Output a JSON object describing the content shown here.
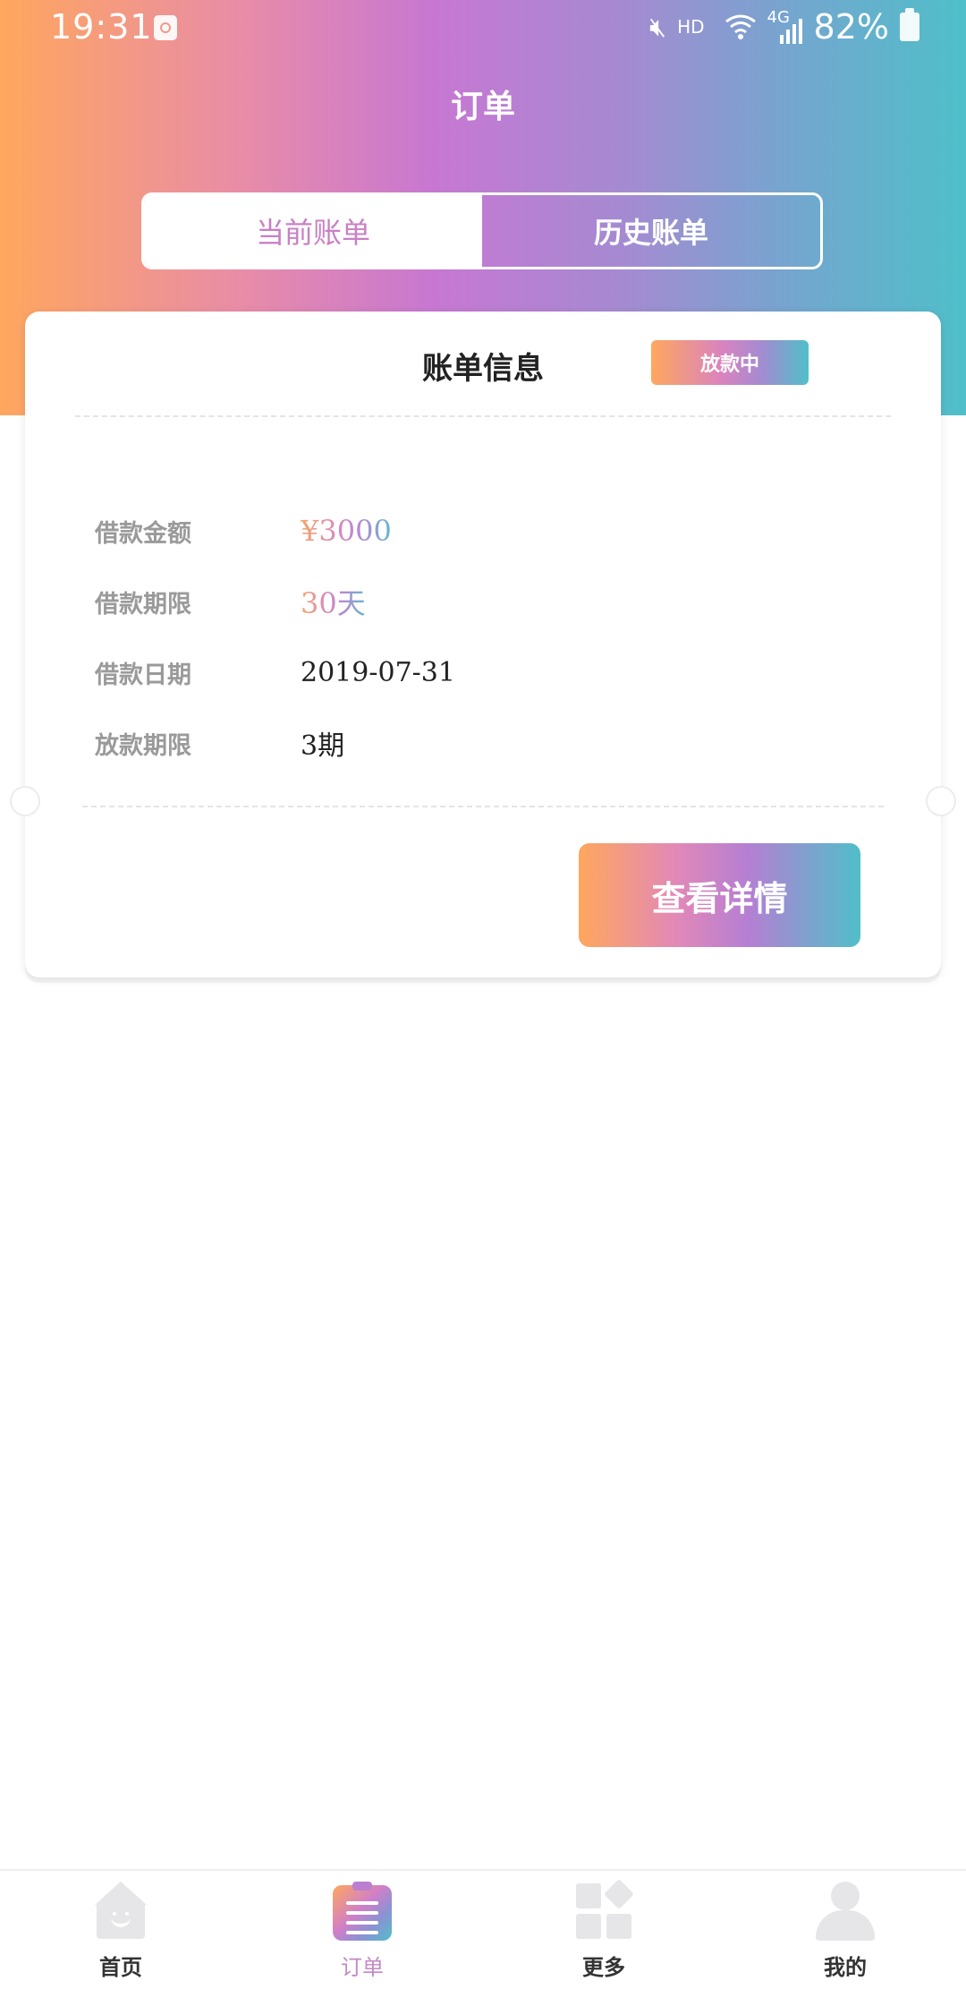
{
  "status_bar": {
    "time": "19:31",
    "hd": "HD",
    "network": "4G",
    "battery": "82%",
    "icons": [
      "notification-icon",
      "mute-icon",
      "wifi-icon",
      "signal-icon",
      "battery-icon"
    ]
  },
  "header": {
    "title": "订单"
  },
  "tabs": {
    "current": "当前账单",
    "history": "历史账单",
    "selected": "history"
  },
  "card": {
    "title": "账单信息",
    "status": "放款中",
    "rows": [
      {
        "label": "借款金额",
        "value": "¥3000"
      },
      {
        "label": "借款期限",
        "value": "30天"
      },
      {
        "label": "借款日期",
        "value": "2019-07-31"
      },
      {
        "label": "放款期限",
        "value": "3期"
      }
    ],
    "button": "查看详情"
  },
  "bottom_nav": {
    "items": [
      {
        "label": "首页",
        "icon": "home-icon"
      },
      {
        "label": "订单",
        "icon": "order-icon",
        "active": true
      },
      {
        "label": "更多",
        "icon": "more-icon"
      },
      {
        "label": "我的",
        "icon": "profile-icon"
      }
    ]
  },
  "colors": {
    "gradient_start": "#ffa75e",
    "gradient_mid": "#c777d2",
    "gradient_end": "#4fbfc9",
    "active_nav_label": "#c389c7"
  }
}
